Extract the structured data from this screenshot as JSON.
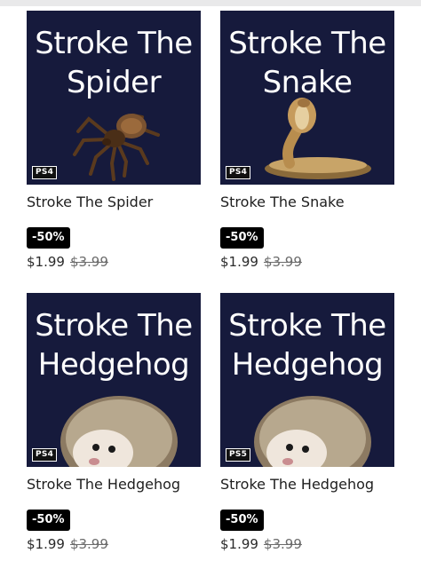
{
  "products": [
    {
      "thumb_title": "Stroke The\nSpider",
      "platform": "PS4",
      "name": "Stroke The Spider",
      "discount": "-50%",
      "price": "$1.99",
      "old_price": "$3.99",
      "icon": "spider-icon"
    },
    {
      "thumb_title": "Stroke The\nSnake",
      "platform": "PS4",
      "name": "Stroke The Snake",
      "discount": "-50%",
      "price": "$1.99",
      "old_price": "$3.99",
      "icon": "snake-icon"
    },
    {
      "thumb_title": "Stroke The\nHedgehog",
      "platform": "PS4",
      "name": "Stroke The Hedgehog",
      "discount": "-50%",
      "price": "$1.99",
      "old_price": "$3.99",
      "icon": "hedgehog-icon"
    },
    {
      "thumb_title": "Stroke The\nHedgehog",
      "platform": "PS5",
      "name": "Stroke The Hedgehog",
      "discount": "-50%",
      "price": "$1.99",
      "old_price": "$3.99",
      "icon": "hedgehog-icon"
    }
  ],
  "colors": {
    "thumb_bg": "#161a3c",
    "badge_bg": "#000000"
  }
}
